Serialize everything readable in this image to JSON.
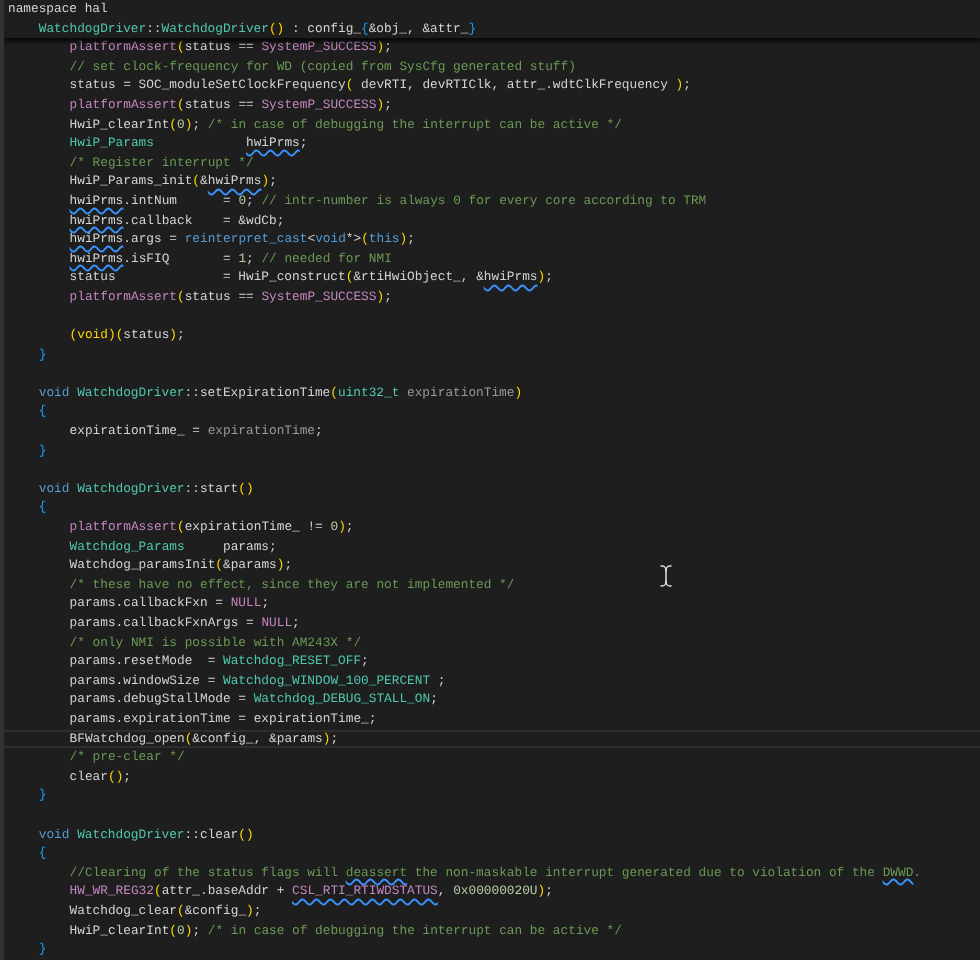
{
  "sticky_lines": [
    {
      "kind": "top",
      "tokens": [
        {
          "text": "namespace hal",
          "kind": "p"
        }
      ]
    },
    {
      "kind": "member",
      "tokens": [
        {
          "text": "WatchdogDriver",
          "kind": "ty"
        },
        {
          "text": "::",
          "kind": "p"
        },
        {
          "text": "WatchdogDriver",
          "kind": "ty"
        },
        {
          "text": "()",
          "kind": "b1"
        },
        {
          "text": " : config_",
          "kind": "p"
        },
        {
          "text": "{",
          "kind": "b3"
        },
        {
          "text": "&obj_, &attr_",
          "kind": "p"
        },
        {
          "text": "}",
          "kind": "b3"
        }
      ]
    }
  ],
  "lines": [
    {
      "kind": "body",
      "tokens": [
        {
          "text": "platformAssert",
          "kind": "mac"
        },
        {
          "text": "(",
          "kind": "b1"
        },
        {
          "text": "status == ",
          "kind": "p"
        },
        {
          "text": "SystemP_SUCCESS",
          "kind": "mac"
        },
        {
          "text": ")",
          "kind": "b1"
        },
        {
          "text": ";",
          "kind": "p"
        }
      ]
    },
    {
      "kind": "body",
      "tokens": [
        {
          "text": "// set clock-frequency for WD (copied from SysCfg generated stuff)",
          "kind": "cm"
        }
      ]
    },
    {
      "kind": "body",
      "tokens": [
        {
          "text": "status = SOC_moduleSetClockFrequency",
          "kind": "p"
        },
        {
          "text": "(",
          "kind": "b1"
        },
        {
          "text": " devRTI, devRTIClk, attr_.wdtClkFrequency ",
          "kind": "p"
        },
        {
          "text": ")",
          "kind": "b1"
        },
        {
          "text": ";",
          "kind": "p"
        }
      ]
    },
    {
      "kind": "body",
      "tokens": [
        {
          "text": "platformAssert",
          "kind": "mac"
        },
        {
          "text": "(",
          "kind": "b1"
        },
        {
          "text": "status == ",
          "kind": "p"
        },
        {
          "text": "SystemP_SUCCESS",
          "kind": "mac"
        },
        {
          "text": ")",
          "kind": "b1"
        },
        {
          "text": ";",
          "kind": "p"
        }
      ]
    },
    {
      "kind": "body",
      "tokens": [
        {
          "text": "HwiP_clearInt",
          "kind": "p"
        },
        {
          "text": "(",
          "kind": "b1"
        },
        {
          "text": "0",
          "kind": "num"
        },
        {
          "text": ")",
          "kind": "b1"
        },
        {
          "text": "; ",
          "kind": "p"
        },
        {
          "text": "/* in case of debugging the interrupt can be active */",
          "kind": "cm"
        }
      ]
    },
    {
      "kind": "body",
      "tokens": [
        {
          "text": "HwiP_Params            ",
          "kind": "ty"
        },
        {
          "text": "hwiPrms",
          "kind": "p",
          "squiggle": true
        },
        {
          "text": ";",
          "kind": "p"
        }
      ]
    },
    {
      "kind": "body",
      "tokens": [
        {
          "text": "/* Register interrupt */",
          "kind": "cm"
        }
      ]
    },
    {
      "kind": "body",
      "tokens": [
        {
          "text": "HwiP_Params_init",
          "kind": "p"
        },
        {
          "text": "(",
          "kind": "b1"
        },
        {
          "text": "&",
          "kind": "p"
        },
        {
          "text": "hwiPrms",
          "kind": "p",
          "squiggle": true
        },
        {
          "text": ")",
          "kind": "b1"
        },
        {
          "text": ";",
          "kind": "p"
        }
      ]
    },
    {
      "kind": "body",
      "tokens": [
        {
          "text": "hwiPrms",
          "kind": "p",
          "squiggle": true
        },
        {
          "text": ".intNum      = ",
          "kind": "p"
        },
        {
          "text": "0",
          "kind": "num"
        },
        {
          "text": "; ",
          "kind": "p"
        },
        {
          "text": "// intr-number is always 0 for every core according to TRM",
          "kind": "cm"
        }
      ]
    },
    {
      "kind": "body",
      "tokens": [
        {
          "text": "hwiPrms",
          "kind": "p",
          "squiggle": true
        },
        {
          "text": ".callback    = &wdCb;",
          "kind": "p"
        }
      ]
    },
    {
      "kind": "body",
      "tokens": [
        {
          "text": "hwiPrms",
          "kind": "p",
          "squiggle": true
        },
        {
          "text": ".args = ",
          "kind": "p"
        },
        {
          "text": "reinterpret_cast",
          "kind": "kw"
        },
        {
          "text": "<",
          "kind": "p"
        },
        {
          "text": "void",
          "kind": "kw"
        },
        {
          "text": "*>",
          "kind": "p"
        },
        {
          "text": "(",
          "kind": "b1"
        },
        {
          "text": "this",
          "kind": "kw"
        },
        {
          "text": ")",
          "kind": "b1"
        },
        {
          "text": ";",
          "kind": "p"
        }
      ]
    },
    {
      "kind": "body",
      "tokens": [
        {
          "text": "hwiPrms",
          "kind": "p",
          "squiggle": true
        },
        {
          "text": ".isFIQ       = ",
          "kind": "p"
        },
        {
          "text": "1",
          "kind": "num"
        },
        {
          "text": "; ",
          "kind": "p"
        },
        {
          "text": "// needed for NMI",
          "kind": "cm"
        }
      ]
    },
    {
      "kind": "body",
      "tokens": [
        {
          "text": "status              = HwiP_construct",
          "kind": "p"
        },
        {
          "text": "(",
          "kind": "b1"
        },
        {
          "text": "&rtiHwiObject_, &",
          "kind": "p"
        },
        {
          "text": "hwiPrms",
          "kind": "p",
          "squiggle": true
        },
        {
          "text": ")",
          "kind": "b1"
        },
        {
          "text": ";",
          "kind": "p"
        }
      ]
    },
    {
      "kind": "body",
      "tokens": [
        {
          "text": "platformAssert",
          "kind": "mac"
        },
        {
          "text": "(",
          "kind": "b1"
        },
        {
          "text": "status == ",
          "kind": "p"
        },
        {
          "text": "SystemP_SUCCESS",
          "kind": "mac"
        },
        {
          "text": ")",
          "kind": "b1"
        },
        {
          "text": ";",
          "kind": "p"
        }
      ]
    },
    {
      "kind": "blank"
    },
    {
      "kind": "body",
      "tokens": [
        {
          "text": "(void)",
          "kind": "b1"
        },
        {
          "text": "(",
          "kind": "b1"
        },
        {
          "text": "status",
          "kind": "p"
        },
        {
          "text": ")",
          "kind": "b1"
        },
        {
          "text": ";",
          "kind": "p"
        }
      ]
    },
    {
      "kind": "member",
      "tokens": [
        {
          "text": "}",
          "kind": "b3"
        }
      ]
    },
    {
      "kind": "blank"
    },
    {
      "kind": "member",
      "tokens": [
        {
          "text": "void ",
          "kind": "kw"
        },
        {
          "text": "WatchdogDriver",
          "kind": "ty"
        },
        {
          "text": "::setExpirationTime",
          "kind": "p"
        },
        {
          "text": "(",
          "kind": "b1"
        },
        {
          "text": "uint32_t ",
          "kind": "ty"
        },
        {
          "text": "expirationTime",
          "kind": "prm"
        },
        {
          "text": ")",
          "kind": "b1"
        }
      ]
    },
    {
      "kind": "member",
      "tokens": [
        {
          "text": "{",
          "kind": "b3"
        }
      ]
    },
    {
      "kind": "body",
      "tokens": [
        {
          "text": "expirationTime_ = ",
          "kind": "p"
        },
        {
          "text": "expirationTime",
          "kind": "prm"
        },
        {
          "text": ";",
          "kind": "p"
        }
      ]
    },
    {
      "kind": "member",
      "tokens": [
        {
          "text": "}",
          "kind": "b3"
        }
      ]
    },
    {
      "kind": "blank"
    },
    {
      "kind": "member",
      "tokens": [
        {
          "text": "void ",
          "kind": "kw"
        },
        {
          "text": "WatchdogDriver",
          "kind": "ty"
        },
        {
          "text": "::start",
          "kind": "p"
        },
        {
          "text": "()",
          "kind": "b1"
        }
      ]
    },
    {
      "kind": "member",
      "tokens": [
        {
          "text": "{",
          "kind": "b3"
        }
      ]
    },
    {
      "kind": "body",
      "tokens": [
        {
          "text": "platformAssert",
          "kind": "mac"
        },
        {
          "text": "(",
          "kind": "b1"
        },
        {
          "text": "expirationTime_ != ",
          "kind": "p"
        },
        {
          "text": "0",
          "kind": "num"
        },
        {
          "text": ")",
          "kind": "b1"
        },
        {
          "text": ";",
          "kind": "p"
        }
      ]
    },
    {
      "kind": "body",
      "tokens": [
        {
          "text": "Watchdog_Params",
          "kind": "ty"
        },
        {
          "text": "     params;",
          "kind": "p"
        }
      ]
    },
    {
      "kind": "body",
      "tokens": [
        {
          "text": "Watchdog_paramsInit",
          "kind": "p"
        },
        {
          "text": "(",
          "kind": "b1"
        },
        {
          "text": "&params",
          "kind": "p"
        },
        {
          "text": ")",
          "kind": "b1"
        },
        {
          "text": ";",
          "kind": "p"
        }
      ]
    },
    {
      "kind": "body",
      "tokens": [
        {
          "text": "/* these have no effect, since they are not implemented */",
          "kind": "cm"
        }
      ]
    },
    {
      "kind": "body",
      "tokens": [
        {
          "text": "params.callbackFxn = ",
          "kind": "p"
        },
        {
          "text": "NULL",
          "kind": "mac"
        },
        {
          "text": ";",
          "kind": "p"
        }
      ]
    },
    {
      "kind": "body",
      "tokens": [
        {
          "text": "params.callbackFxnArgs = ",
          "kind": "p"
        },
        {
          "text": "NULL",
          "kind": "mac"
        },
        {
          "text": ";",
          "kind": "p"
        }
      ]
    },
    {
      "kind": "body",
      "tokens": [
        {
          "text": "/* only NMI is possible with AM243X */",
          "kind": "cm"
        }
      ]
    },
    {
      "kind": "body",
      "tokens": [
        {
          "text": "params.resetMode  = ",
          "kind": "p"
        },
        {
          "text": "Watchdog_RESET_OFF",
          "kind": "ty"
        },
        {
          "text": ";",
          "kind": "p"
        }
      ]
    },
    {
      "kind": "body",
      "tokens": [
        {
          "text": "params.windowSize = ",
          "kind": "p"
        },
        {
          "text": "Watchdog_WINDOW_100_PERCENT",
          "kind": "ty"
        },
        {
          "text": " ;",
          "kind": "p"
        }
      ]
    },
    {
      "kind": "body",
      "tokens": [
        {
          "text": "params.debugStallMode = ",
          "kind": "p"
        },
        {
          "text": "Watchdog_DEBUG_STALL_ON",
          "kind": "ty"
        },
        {
          "text": ";",
          "kind": "p"
        }
      ]
    },
    {
      "kind": "body",
      "tokens": [
        {
          "text": "params.expirationTime = expirationTime_;",
          "kind": "p"
        }
      ]
    },
    {
      "kind": "body",
      "current": true,
      "tokens": [
        {
          "text": "BFWatchdog_open",
          "kind": "p"
        },
        {
          "text": "(",
          "kind": "b1"
        },
        {
          "text": "&config_, &params",
          "kind": "p"
        },
        {
          "text": ")",
          "kind": "b1"
        },
        {
          "text": ";",
          "kind": "p"
        }
      ]
    },
    {
      "kind": "body",
      "tokens": [
        {
          "text": "/* pre-clear */",
          "kind": "cm"
        }
      ]
    },
    {
      "kind": "body",
      "tokens": [
        {
          "text": "clear",
          "kind": "p"
        },
        {
          "text": "()",
          "kind": "b1"
        },
        {
          "text": ";",
          "kind": "p"
        }
      ]
    },
    {
      "kind": "member",
      "tokens": [
        {
          "text": "}",
          "kind": "b3"
        }
      ]
    },
    {
      "kind": "blank"
    },
    {
      "kind": "member",
      "tokens": [
        {
          "text": "void ",
          "kind": "kw"
        },
        {
          "text": "WatchdogDriver",
          "kind": "ty"
        },
        {
          "text": "::clear",
          "kind": "p"
        },
        {
          "text": "()",
          "kind": "b1"
        }
      ]
    },
    {
      "kind": "member",
      "tokens": [
        {
          "text": "{",
          "kind": "b3"
        }
      ]
    },
    {
      "kind": "body",
      "tokens": [
        {
          "text": "//Clearing of the status flags will ",
          "kind": "cm"
        },
        {
          "text": "deassert",
          "kind": "cm",
          "squiggle": true
        },
        {
          "text": " the non-maskable interrupt generated due to violation of the ",
          "kind": "cm"
        },
        {
          "text": "DWWD",
          "kind": "cm",
          "squiggle": true
        },
        {
          "text": ".",
          "kind": "cm"
        }
      ]
    },
    {
      "kind": "body",
      "tokens": [
        {
          "text": "HW_WR_REG32",
          "kind": "mac"
        },
        {
          "text": "(",
          "kind": "b1"
        },
        {
          "text": "attr_.baseAddr + ",
          "kind": "p"
        },
        {
          "text": "CSL_RTI_RTIWDSTATUS",
          "kind": "mac",
          "squiggle": true
        },
        {
          "text": ", ",
          "kind": "p"
        },
        {
          "text": "0x00000020U",
          "kind": "num"
        },
        {
          "text": ")",
          "kind": "b1"
        },
        {
          "text": ";",
          "kind": "p"
        }
      ]
    },
    {
      "kind": "body",
      "tokens": [
        {
          "text": "Watchdog_clear",
          "kind": "p"
        },
        {
          "text": "(",
          "kind": "b1"
        },
        {
          "text": "&config_",
          "kind": "p"
        },
        {
          "text": ")",
          "kind": "b1"
        },
        {
          "text": ";",
          "kind": "p"
        }
      ]
    },
    {
      "kind": "body",
      "tokens": [
        {
          "text": "HwiP_clearInt",
          "kind": "p"
        },
        {
          "text": "(",
          "kind": "b1"
        },
        {
          "text": "0",
          "kind": "num"
        },
        {
          "text": ")",
          "kind": "b1"
        },
        {
          "text": "; ",
          "kind": "p"
        },
        {
          "text": "/* in case of debugging the interrupt can be active */",
          "kind": "cm"
        }
      ]
    },
    {
      "kind": "member",
      "tokens": [
        {
          "text": "}",
          "kind": "b3"
        }
      ]
    }
  ]
}
